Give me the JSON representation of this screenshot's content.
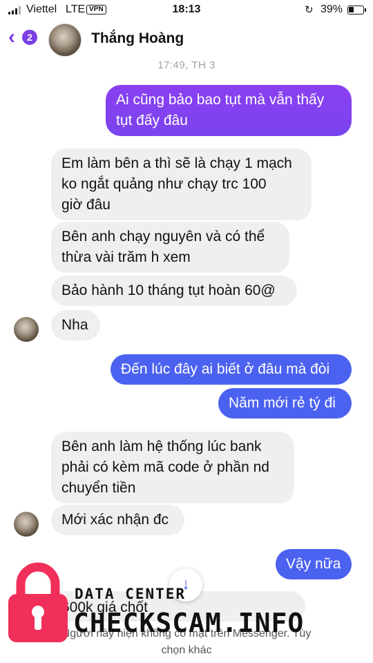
{
  "status": {
    "carrier": "Viettel",
    "network": "LTE",
    "vpn": "VPN",
    "time": "18:13",
    "orientation_icon": "orientation-lock-icon",
    "battery": "39%",
    "battery_level": 0.39
  },
  "header": {
    "back_icon": "chevron-left-icon",
    "unread_badge": "2",
    "contact_name": "Thắng Hoàng"
  },
  "conversation": {
    "timestamp": "17:49, TH 3",
    "messages": [
      {
        "side": "out",
        "text": "Ai cũng bảo bao tụt mà vẫn thấy\ntụt đấy đâu"
      },
      {
        "side": "in",
        "text": "Em làm bên a thì sẽ là chạy 1 mạch\nko ngắt quảng như chạy trc 100\ngiờ đâu"
      },
      {
        "side": "in",
        "text": "Bên anh chạy nguyên và có thể\nthừa vài trăm h xem"
      },
      {
        "side": "in",
        "text": "Bảo hành 10 tháng tụt hoàn 60@"
      },
      {
        "side": "in",
        "text": "Nha"
      },
      {
        "side": "out",
        "text": "Đến lúc đây ai biết ở đâu mà đòi"
      },
      {
        "side": "out",
        "text": "Năm mới rẻ tý đi"
      },
      {
        "side": "in",
        "text": "Bên anh làm hệ thống lúc bank\nphải có kèm mã code ở phần nd\nchuyển tiền"
      },
      {
        "side": "in",
        "text": "Mới xác nhận đc"
      },
      {
        "side": "out",
        "text": "Vậy nữa"
      },
      {
        "side": "in",
        "text": "600k giá chốt"
      }
    ]
  },
  "footer": {
    "note": "Người này hiện không có mặt trên Messenger. Tùy\nchọn khác"
  },
  "watermark": {
    "small": "DATA CENTER",
    "big": "CHECKSCAM.INFO"
  },
  "colors": {
    "accent": "#7b3fe4",
    "bubble_out_purple": "#8a3ff0",
    "bubble_out_blue": "#4b62f0",
    "bubble_in": "#efefef",
    "watermark_lock": "#f0305a"
  }
}
